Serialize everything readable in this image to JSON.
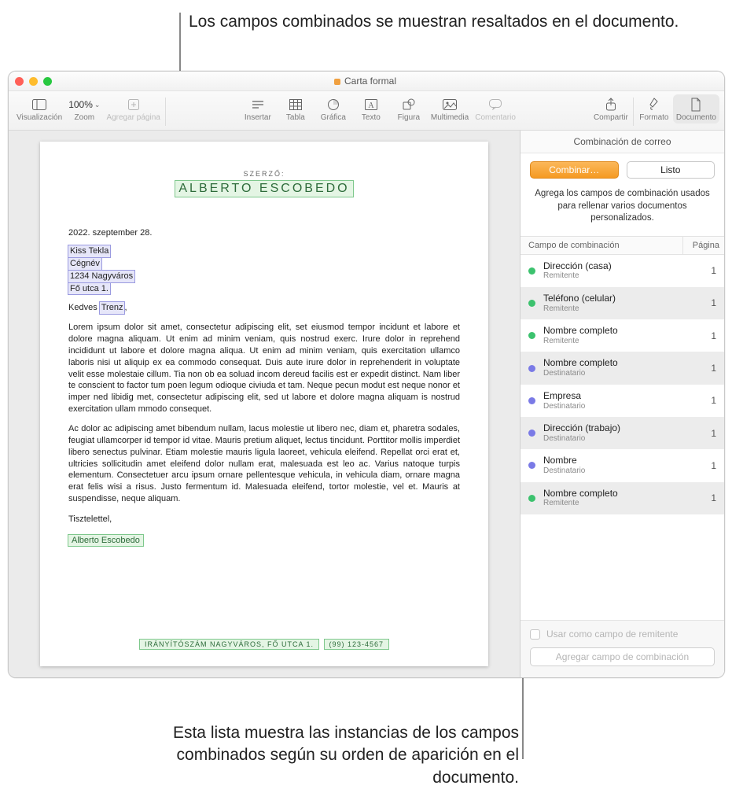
{
  "annotations": {
    "top": "Los campos combinados se muestran resaltados en el documento.",
    "bottom": "Esta lista muestra las instancias de los campos combinados según su orden de aparición en el documento."
  },
  "window": {
    "title": "Carta formal"
  },
  "toolbar": {
    "view": "Visualización",
    "zoom_label": "Zoom",
    "zoom_value": "100%",
    "add_page": "Agregar página",
    "insert": "Insertar",
    "table": "Tabla",
    "chart": "Gráfica",
    "text": "Texto",
    "shape": "Figura",
    "media": "Multimedia",
    "comment": "Comentario",
    "share": "Compartir",
    "format": "Formato",
    "document": "Documento"
  },
  "document": {
    "szerzo_label": "SZERZŐ:",
    "author_name": "ALBERTO ESCOBEDO",
    "date": "2022. szeptember 28.",
    "recipient_lines": [
      "Kiss Tekla",
      "Cégnév",
      "1234 Nagyváros",
      "Fő utca 1."
    ],
    "greeting_prefix": "Kedves ",
    "greeting_name": "Trenz",
    "greeting_suffix": ",",
    "para1": "Lorem ipsum dolor sit amet, consectetur adipiscing elit, set eiusmod tempor incidunt et labore et dolore magna aliquam. Ut enim ad minim veniam, quis nostrud exerc. Irure dolor in reprehend incididunt ut labore et dolore magna aliqua. Ut enim ad minim veniam, quis exercitation ullamco laboris nisi ut aliquip ex ea commodo consequat. Duis aute irure dolor in reprehenderit in voluptate velit esse molestaie cillum. Tia non ob ea soluad incom dereud facilis est er expedit distinct. Nam liber te conscient to factor tum poen legum odioque civiuda et tam. Neque pecun modut est neque nonor et imper ned libidig met, consectetur adipiscing elit, sed ut labore et dolore magna aliquam is nostrud exercitation ullam mmodo consequet.",
    "para2": "Ac dolor ac adipiscing amet bibendum nullam, lacus molestie ut libero nec, diam et, pharetra sodales, feugiat ullamcorper id tempor id vitae. Mauris pretium aliquet, lectus tincidunt. Porttitor mollis imperdiet libero senectus pulvinar. Etiam molestie mauris ligula laoreet, vehicula eleifend. Repellat orci erat et, ultricies sollicitudin amet eleifend dolor nullam erat, malesuada est leo ac. Varius natoque turpis elementum. Consectetuer arcu ipsum ornare pellentesque vehicula, in vehicula diam, ornare magna erat felis wisi a risus. Justo fermentum id. Malesuada eleifend, tortor molestie, vel et. Mauris at suspendisse, neque aliquam.",
    "closing": "Tisztelettel,",
    "signature": "Alberto Escobedo",
    "footer_addr": "IRÁNYÍTÓSZÁM NAGYVÁROS, FŐ UTCA 1.",
    "footer_phone": "(99) 123-4567"
  },
  "inspector": {
    "title": "Combinación de correo",
    "combine_btn": "Combinar…",
    "done_btn": "Listo",
    "help_text": "Agrega los campos de combinación usados para rellenar varios documentos personalizados.",
    "col_name": "Campo de combinación",
    "col_page": "Página",
    "fields": [
      {
        "name": "Dirección (casa)",
        "role": "Remitente",
        "kind": "sender",
        "page": 1
      },
      {
        "name": "Teléfono (celular)",
        "role": "Remitente",
        "kind": "sender",
        "page": 1
      },
      {
        "name": "Nombre completo",
        "role": "Remitente",
        "kind": "sender",
        "page": 1
      },
      {
        "name": "Nombre completo",
        "role": "Destinatario",
        "kind": "recipient",
        "page": 1
      },
      {
        "name": "Empresa",
        "role": "Destinatario",
        "kind": "recipient",
        "page": 1
      },
      {
        "name": "Dirección (trabajo)",
        "role": "Destinatario",
        "kind": "recipient",
        "page": 1
      },
      {
        "name": "Nombre",
        "role": "Destinatario",
        "kind": "recipient",
        "page": 1
      },
      {
        "name": "Nombre completo",
        "role": "Remitente",
        "kind": "sender",
        "page": 1
      }
    ],
    "use_as_sender": "Usar como campo de remitente",
    "add_field": "Agregar campo de combinación"
  }
}
